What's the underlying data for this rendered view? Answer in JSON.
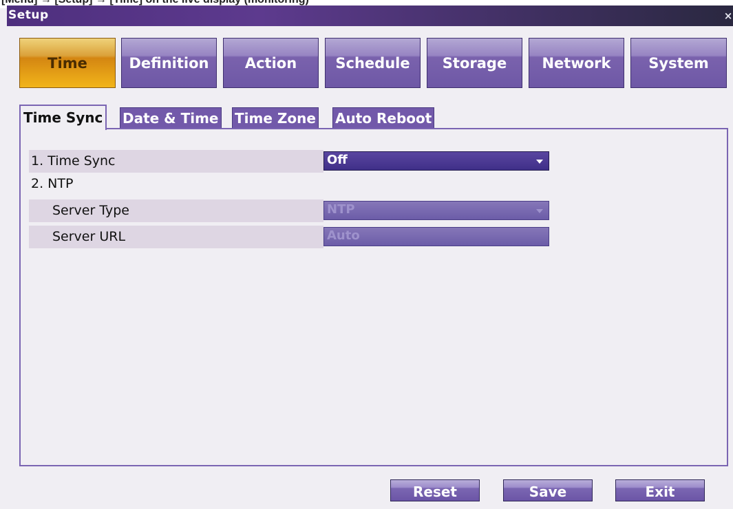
{
  "caption": "[Menu] → [Setup] → [Time] on the live display (monitoring)",
  "window": {
    "title": "Setup",
    "close_glyph": "×"
  },
  "main_tabs": [
    {
      "label": "Time",
      "active": true
    },
    {
      "label": "Definition",
      "active": false
    },
    {
      "label": "Action",
      "active": false
    },
    {
      "label": "Schedule",
      "active": false
    },
    {
      "label": "Storage",
      "active": false
    },
    {
      "label": "Network",
      "active": false
    },
    {
      "label": "System",
      "active": false
    }
  ],
  "sub_tabs": [
    {
      "label": "Time Sync",
      "active": true
    },
    {
      "label": "Date & Time",
      "active": false
    },
    {
      "label": "Time Zone",
      "active": false
    },
    {
      "label": "Auto Reboot",
      "active": false
    }
  ],
  "settings": {
    "time_sync": {
      "label": "1. Time Sync",
      "value": "Off",
      "enabled": true
    },
    "ntp": {
      "label": "2. NTP"
    },
    "server_type": {
      "label": "Server Type",
      "value": "NTP",
      "enabled": false
    },
    "server_url": {
      "label": "Server URL",
      "value": "Auto",
      "enabled": false
    }
  },
  "buttons": {
    "reset": "Reset",
    "save": "Save",
    "exit": "Exit"
  },
  "colors": {
    "accent": "#7259aa",
    "active_tab": "#d48612",
    "title_bar": "#4e2f7e",
    "panel_border": "#7a64b2",
    "row_shade": "#ded6e3"
  }
}
